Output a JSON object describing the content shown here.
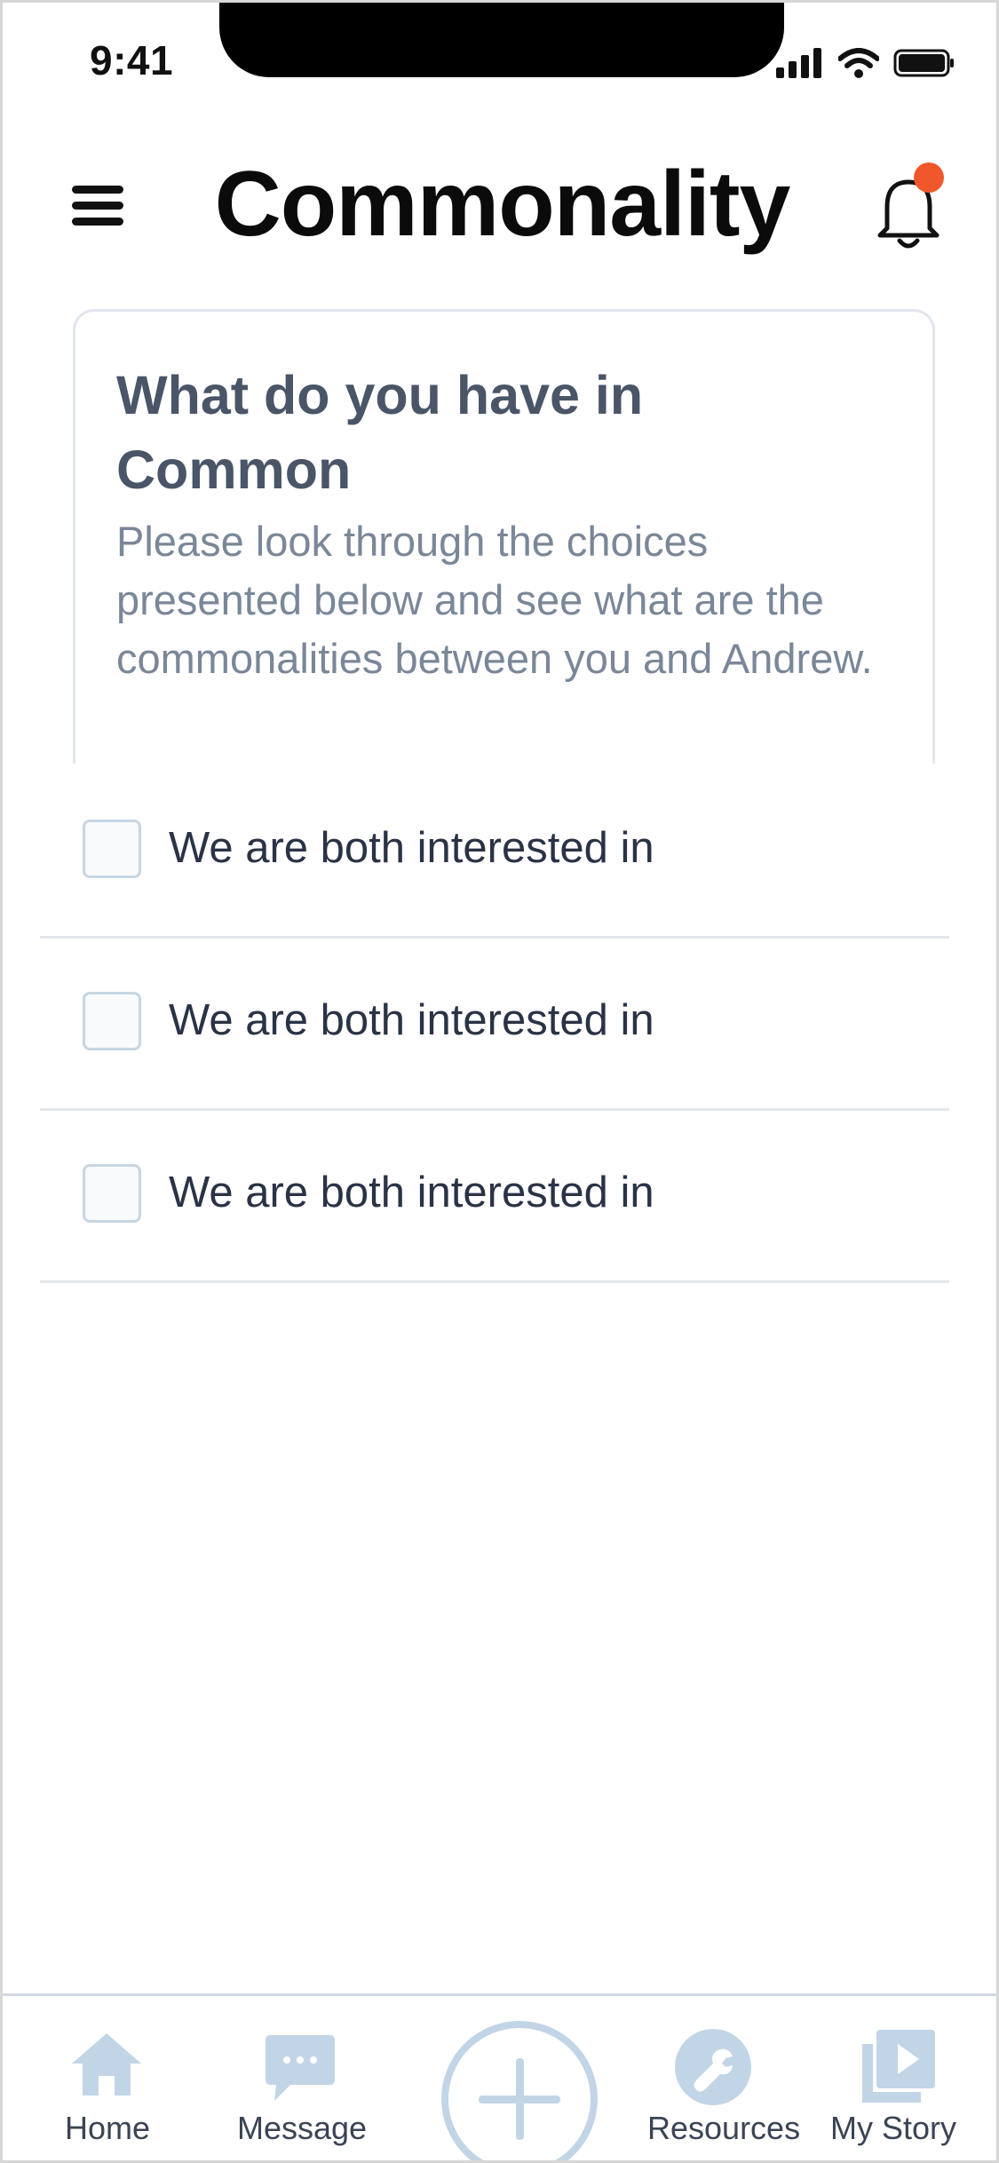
{
  "status_bar": {
    "time": "9:41"
  },
  "header": {
    "title": "Commonality"
  },
  "intro": {
    "title": "What do you have in Common",
    "description": "Please look through the choices presented below and see what are the commonalities between you and Andrew."
  },
  "choices": [
    {
      "label": "We are both interested in",
      "checked": false
    },
    {
      "label": "We are both interested in",
      "checked": false
    },
    {
      "label": "We are both interested in",
      "checked": false
    }
  ],
  "tabbar": {
    "tabs": [
      {
        "label": "Home",
        "icon": "home-icon"
      },
      {
        "label": "Message",
        "icon": "message-icon"
      },
      {
        "label": "Resources",
        "icon": "wrench-icon"
      },
      {
        "label": "My Story",
        "icon": "video-library-icon"
      }
    ],
    "center_action_icon": "plus-icon"
  },
  "colors": {
    "accent": "#c2d5e6",
    "notification_dot": "#f0582b",
    "title_text": "#0b0b0b",
    "body_text": "#2a3346",
    "muted_text": "#7a8799"
  }
}
